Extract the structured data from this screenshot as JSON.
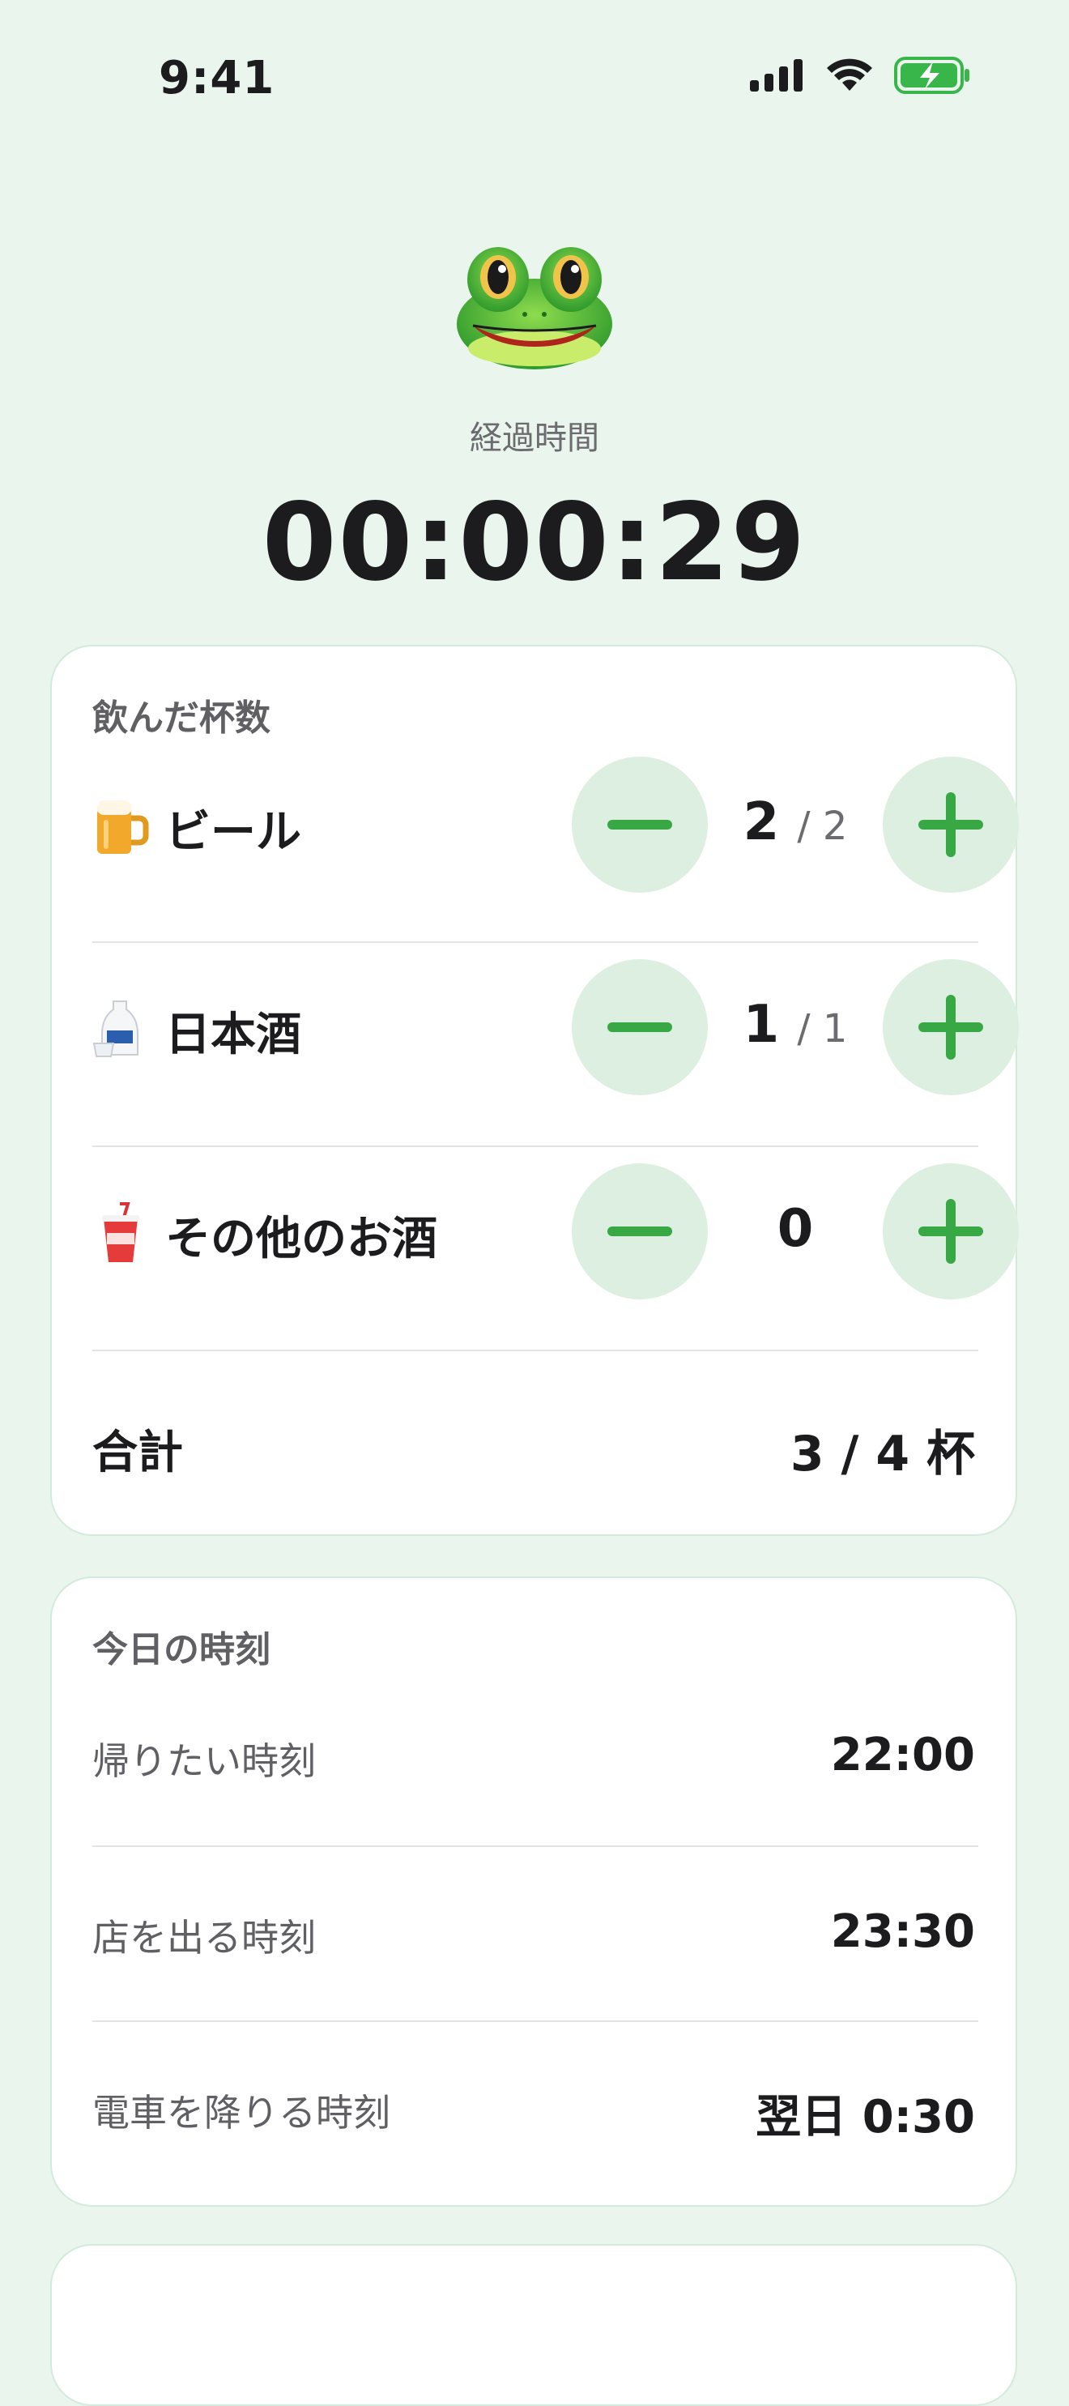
{
  "status_bar": {
    "time": "9:41",
    "icons": [
      "signal-icon",
      "wifi-icon",
      "battery-charging-icon"
    ]
  },
  "hero": {
    "icon": "frog-face-icon",
    "elapsed_label": "経過時間",
    "elapsed_time": "00:00:29"
  },
  "drinks_card": {
    "title": "飲んだ杯数",
    "items": [
      {
        "icon": "beer-mug-icon",
        "name": "ビール",
        "count": "2",
        "limit": "/ 2"
      },
      {
        "icon": "sake-icon",
        "name": "日本酒",
        "count": "1",
        "limit": "/ 1"
      },
      {
        "icon": "cup-with-straw-icon",
        "name": "その他のお酒",
        "count": "0",
        "limit": ""
      }
    ],
    "total_label": "合計",
    "total_value": "3 / 4 杯"
  },
  "times_card": {
    "title": "今日の時刻",
    "rows": [
      {
        "label": "帰りたい時刻",
        "value": "22:00"
      },
      {
        "label": "店を出る時刻",
        "value": "23:30"
      },
      {
        "label": "電車を降りる時刻",
        "value": "翌日 0:30"
      }
    ]
  },
  "colors": {
    "background": "#e9f5ed",
    "accent": "#38a845",
    "button_bg": "#dcefe1"
  }
}
